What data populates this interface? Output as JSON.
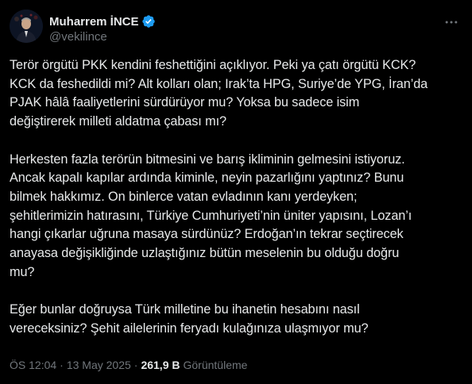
{
  "author": {
    "display_name": "Muharrem İNCE",
    "handle": "@vekilince",
    "verified": true,
    "verified_color": "#1d9bf0"
  },
  "tweet": {
    "paragraphs": [
      [
        "Terör örgütü PKK kendini feshettiğini açıklıyor. Peki ya çatı örgütü KCK?",
        "KCK da feshedildi mi? Alt kolları olan; Irak’ta HPG, Suriye’de YPG, İran’da",
        "PJAK hâlâ faaliyetlerini sürdürüyor mu? Yoksa bu sadece isim",
        "değiştirerek milleti aldatma çabası mı?"
      ],
      [
        "Herkesten fazla terörün bitmesini ve barış ikliminin gelmesini istiyoruz.",
        "Ancak kapalı kapılar ardında kiminle, neyin pazarlığını yaptınız? Bunu",
        "bilmek hakkımız. On binlerce vatan evladının kanı yerdeyken;",
        "şehitlerimizin hatırasını, Türkiye Cumhuriyeti’nin üniter yapısını, Lozan’ı",
        "hangi çıkarlar uğruna masaya sürdünüz? Erdoğan’ın tekrar seçtirecek",
        "anayasa değişikliğinde uzlaştığınız bütün meselenin bu olduğu doğru",
        "mu?"
      ],
      [
        "Eğer bunlar doğruysa Türk milletine bu ihanetin hesabını nasıl",
        "vereceksiniz? Şehit ailelerinin feryadı kulağınıza ulaşmıyor mu?"
      ]
    ]
  },
  "meta": {
    "time": "ÖS 12:04",
    "separator": "·",
    "date": "13 May 2025",
    "views_count": "261,9 B",
    "views_label": "Görüntüleme"
  },
  "icons": {
    "avatar": "profile-photo",
    "verified": "verified-badge-icon",
    "more": "more-options-icon"
  },
  "colors": {
    "background": "#000000",
    "text_primary": "#e7e9ea",
    "text_secondary": "#71767b",
    "accent": "#1d9bf0"
  }
}
